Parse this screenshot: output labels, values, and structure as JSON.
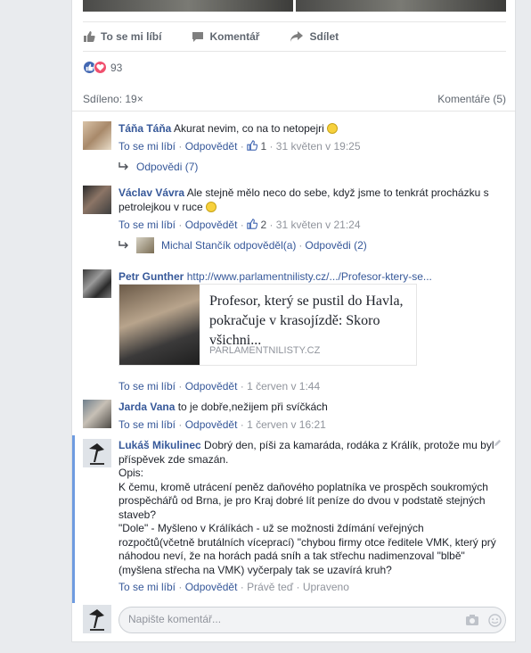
{
  "post": {
    "actions": {
      "like": "To se mi líbí",
      "comment": "Komentář",
      "share": "Sdílet"
    },
    "reactions_count": "93",
    "shared": "Sdíleno: 19×",
    "comments_count": "Komentáře (5)"
  },
  "comments": [
    {
      "author": "Táňa Táňa",
      "text": " Akurat nevim, co na to netopejri ",
      "like": "To se mi líbí",
      "reply": "Odpovědět",
      "likes": "1",
      "time": "31 květen v 19:25",
      "replies_label": "Odpovědi (7)"
    },
    {
      "author": "Václav Vávra",
      "text_line1": " Ale stejně mělo neco do sebe, když jsme to tenkrát procházku s",
      "text_line2": "petrolejkou v ruce ",
      "like": "To se mi líbí",
      "reply": "Odpovědět",
      "likes": "2",
      "time": "31 květen v 21:24",
      "reply_author": "Michal Stančík odpověděl(a)",
      "replies_label": "Odpovědi (2)"
    },
    {
      "author": "Petr Gunther",
      "link": "http://www.parlamentnilisty.cz/.../Profesor-ktery-se...",
      "preview_title": "Profesor, který se pustil do Havla, pokračuje v krasojízdě: Skoro všichni...",
      "preview_domain": "PARLAMENTNILISTY.CZ",
      "like": "To se mi líbí",
      "reply": "Odpovědět",
      "time": "1 červen v 1:44"
    },
    {
      "author": "Jarda Vana",
      "text": " to je dobře,nežijem při svíčkách",
      "like": "To se mi líbí",
      "reply": "Odpovědět",
      "time": "1 červen v 16:21"
    },
    {
      "author": "Lukáš Mikulinec",
      "lines": [
        " Dobrý den, píši za kamaráda, rodáka z Králík, protože mu byl",
        "příspěvek zde smazán.",
        "Opis:",
        "K čemu, kromě utrácení peněz daňového poplatníka ve prospěch soukromých",
        "prospěchářů od Brna, je pro Kraj dobré lít peníze do dvou v podstatě stejných",
        "staveb?",
        "\"Dole\" - Myšleno v Králíkách - už se možnosti ždímání veřejných",
        "rozpočtů(včetně brutálních víceprací) \"chybou firmy otce ředitele VMK, který prý",
        "náhodou neví, že na horách padá sníh a tak střechu nadimenzoval \"blbě\"",
        "(myšlena střecha na VMK) vyčerpaly tak se uzavírá kruh?"
      ],
      "like": "To se mi líbí",
      "reply": "Odpovědět",
      "time": "Právě teď",
      "edited": "Upraveno"
    }
  ],
  "composer": {
    "placeholder": "Napište komentář..."
  }
}
